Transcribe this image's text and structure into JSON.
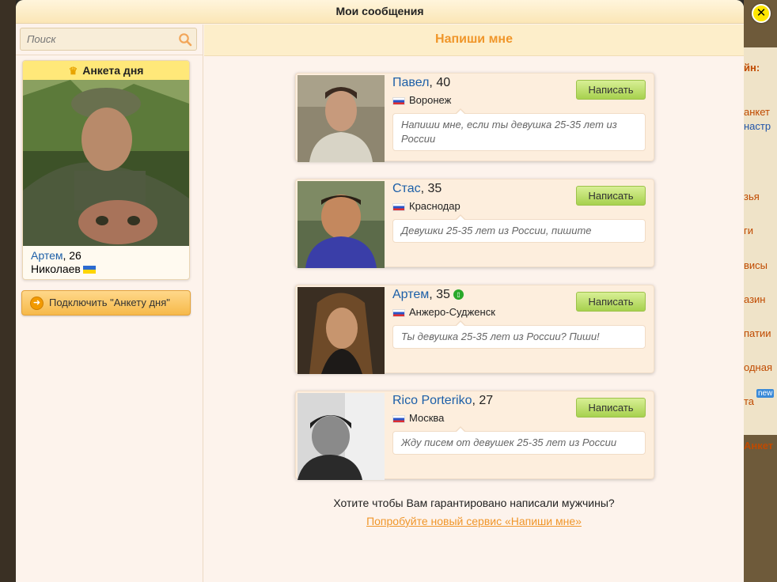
{
  "modal": {
    "title": "Мои сообщения"
  },
  "search": {
    "placeholder": "Поиск"
  },
  "anketa_dnya": {
    "header": "Анкета дня",
    "name": "Артем",
    "age": ", 26",
    "city": "Николаев",
    "flag": "ua-flag-icon"
  },
  "connect_button": {
    "label": "Подключить \"Анкету дня\""
  },
  "content": {
    "title": "Напиши мне"
  },
  "cards": [
    {
      "name": "Павел",
      "age": ", 40",
      "city": "Воронеж",
      "message": "Напиши мне, если ты девушка 25-35 лет из России",
      "button": "Написать"
    },
    {
      "name": "Стас",
      "age": ", 35",
      "city": "Краснодар",
      "message": "Девушки 25-35 лет из России, пишите",
      "button": "Написать"
    },
    {
      "name": "Артем",
      "age": ", 35",
      "city": "Анжеро-Судженск",
      "message": "Ты девушка 25-35 лет из России? Пиши!",
      "button": "Написать",
      "online": "online-icon"
    },
    {
      "name": "Rico Porteriko",
      "age": ", 27",
      "city": "Москва",
      "message": "Жду писем от девушек 25-35 лет из России",
      "button": "Написать"
    }
  ],
  "promo": {
    "text": "Хотите чтобы Вам гарантировано написали мужчины?",
    "link": "Попробуйте новый сервис «Напиши мне»"
  },
  "background_fragments": [
    "йн:",
    "анкет",
    "настр",
    "зья",
    "ги",
    "висы",
    "азин",
    "патии",
    "одная",
    "new",
    "та",
    "Анкет"
  ],
  "colors": {
    "accent_orange": "#f0962a",
    "link_blue": "#1c5fa8",
    "button_green": "#a7d14e",
    "header_yellow": "#ffe879"
  }
}
